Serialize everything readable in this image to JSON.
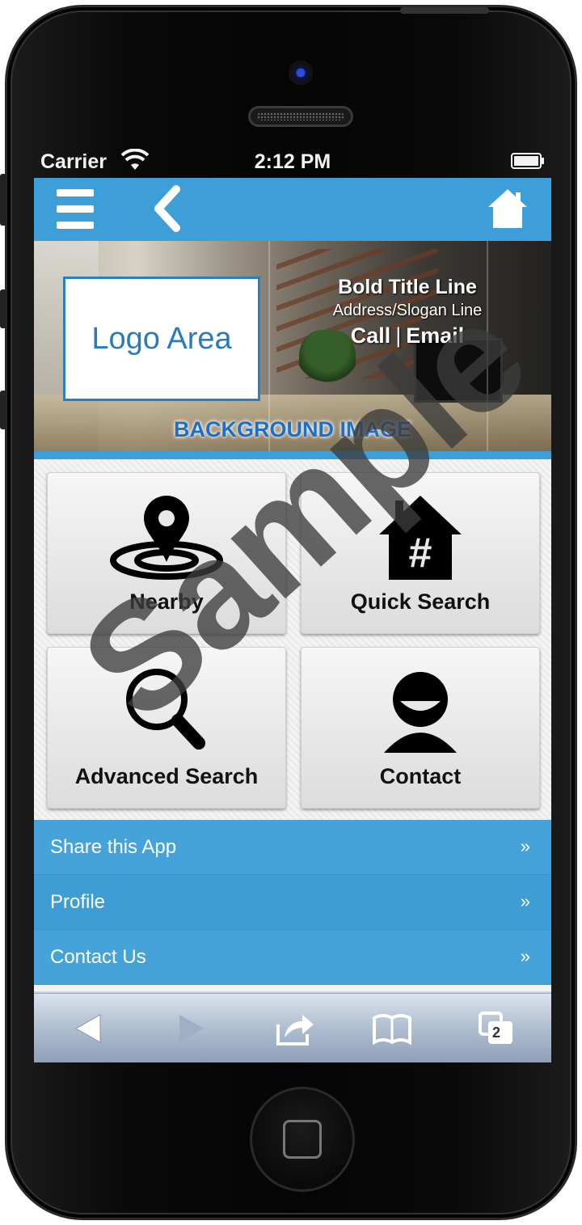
{
  "status_bar": {
    "carrier": "Carrier",
    "time": "2:12 PM"
  },
  "navbar": {
    "menu_icon": "hamburger-icon",
    "back_icon": "back-chevron-icon",
    "home_icon": "home-icon"
  },
  "hero": {
    "logo_text": "Logo Area",
    "title": "Bold Title Line",
    "subtitle": "Address/Slogan Line",
    "call": "Call",
    "separator": "|",
    "email": "Email",
    "background_label": "BACKGROUND IMAGE"
  },
  "tiles": [
    {
      "label": "Nearby",
      "icon": "map-pin-icon"
    },
    {
      "label": "Quick Search",
      "icon": "house-hash-icon"
    },
    {
      "label": "Advanced Search",
      "icon": "magnifier-icon"
    },
    {
      "label": "Contact",
      "icon": "person-icon"
    }
  ],
  "list": [
    {
      "label": "Share this App",
      "arrow": "»"
    },
    {
      "label": "Profile",
      "arrow": "»"
    },
    {
      "label": "Contact Us",
      "arrow": "»"
    }
  ],
  "toolbar": {
    "tabs_count": "2"
  },
  "watermark": "Sample",
  "colors": {
    "accent": "#3d9ed8",
    "logo_text": "#2a7bbd",
    "list_bg": "#45a3da"
  }
}
